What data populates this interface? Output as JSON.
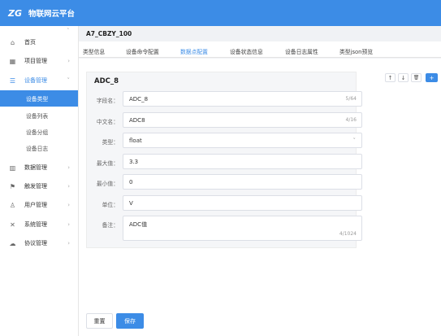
{
  "header": {
    "logo_text": "ZG",
    "app_title": "物联网云平台"
  },
  "sidebar": {
    "items": [
      {
        "label": "首页",
        "icon": "home-icon",
        "glyph": "⌂"
      },
      {
        "label": "项目管理",
        "icon": "project-icon",
        "glyph": "▦"
      },
      {
        "label": "设备管理",
        "icon": "device-icon",
        "glyph": "☰"
      },
      {
        "label": "数据管理",
        "icon": "data-icon",
        "glyph": "▥"
      },
      {
        "label": "触发管理",
        "icon": "flag-icon",
        "glyph": "⚑"
      },
      {
        "label": "用户管理",
        "icon": "user-icon",
        "glyph": "♙"
      },
      {
        "label": "系统管理",
        "icon": "tools-icon",
        "glyph": "✕"
      },
      {
        "label": "协议管理",
        "icon": "cloud-icon",
        "glyph": "☁"
      }
    ],
    "submenu": [
      "设备类型",
      "设备列表",
      "设备分组",
      "设备日志"
    ]
  },
  "page": {
    "title": "A7_CBZY_100"
  },
  "tabs": [
    "类型信息",
    "设备命令配置",
    "数据点配置",
    "设备状态信息",
    "设备日志属性",
    "类型json预览"
  ],
  "toolbar": {
    "up": "↑",
    "down": "↓",
    "delete": "🗑",
    "add": "+"
  },
  "panel": {
    "title": "ADC_8"
  },
  "form": {
    "field_name": {
      "label": "字段名：",
      "value": "ADC_8",
      "count": "5/64"
    },
    "cn_name": {
      "label": "中文名：",
      "value": "ADC8",
      "count": "4/16"
    },
    "type": {
      "label": "类型：",
      "value": "float"
    },
    "max": {
      "label": "最大值：",
      "value": "3.3"
    },
    "min": {
      "label": "最小值：",
      "value": "0"
    },
    "unit": {
      "label": "单位：",
      "value": "V"
    },
    "remark": {
      "label": "备注：",
      "value": "ADC值",
      "count": "4/1024"
    }
  },
  "actions": {
    "reset": "重置",
    "save": "保存"
  }
}
